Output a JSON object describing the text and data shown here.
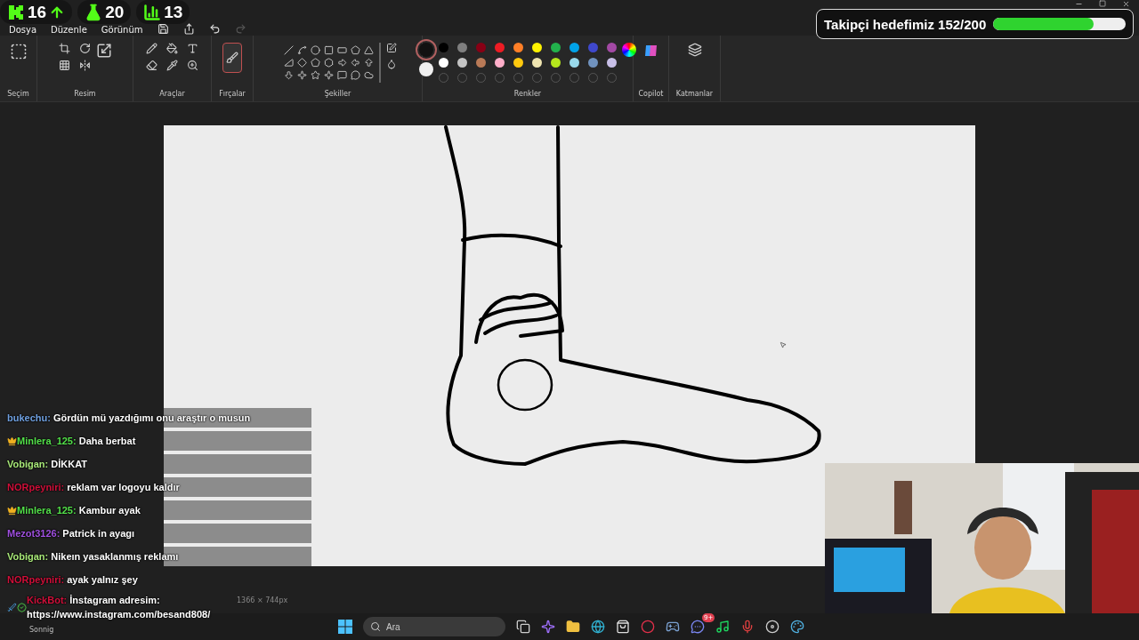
{
  "stream_stats": [
    {
      "kind": "kick",
      "value": "16"
    },
    {
      "kind": "followers",
      "value": "20"
    },
    {
      "kind": "viewers",
      "value": "13"
    }
  ],
  "menu": [
    "Dosya",
    "Düzenle",
    "Görünüm"
  ],
  "ribbon_groups": [
    "Seçim",
    "Resim",
    "Araçlar",
    "Fırçalar",
    "Şekiller",
    "Renkler",
    "Copilot",
    "Katmanlar"
  ],
  "colors": {
    "active": [
      {
        "color": "#111111",
        "selected": true
      },
      {
        "color": "#f0f0f0",
        "selected": false
      }
    ],
    "swatches": [
      {
        "color": "#000000"
      },
      {
        "color": "#7f7f7f"
      },
      {
        "color": "#880015"
      },
      {
        "color": "#ed1c24"
      },
      {
        "color": "#ff7f27"
      },
      {
        "color": "#fff200"
      },
      {
        "color": "#22b14c"
      },
      {
        "color": "#00a2e8"
      },
      {
        "color": "#3f48cc"
      },
      {
        "color": "#a349a4"
      },
      {
        "color": "#ffffff"
      },
      {
        "color": "#c3c3c3"
      },
      {
        "color": "#b97a57"
      },
      {
        "color": "#ffaec9"
      },
      {
        "color": "#ffc90e"
      },
      {
        "color": "#efe4b0"
      },
      {
        "color": "#b5e61d"
      },
      {
        "color": "#99d9ea"
      },
      {
        "color": "#7092be"
      },
      {
        "color": "#c8bfe7"
      }
    ]
  },
  "follower_goal": {
    "label": "Takipçi hedefimiz 152/200",
    "level": 0.76
  },
  "chat": [
    {
      "user": "bukechu:",
      "color": "#6fa0e0",
      "crown": false,
      "message": "Gördün mü yazdığımı onu araştır o musun"
    },
    {
      "user": "Minlera_125:",
      "color": "#53e04a",
      "crown": true,
      "message": "Daha berbat"
    },
    {
      "user": "Vobigan:",
      "color": "#a8e878",
      "crown": false,
      "message": "DİKKAT"
    },
    {
      "user": "NORpeyniri:",
      "color": "#d0103a",
      "crown": false,
      "message": "reklam var logoyu kaldır"
    },
    {
      "user": "Minlera_125:",
      "color": "#53e04a",
      "crown": true,
      "message": "Kambur ayak"
    },
    {
      "user": "Mezot3126:",
      "color": "#a050e0",
      "crown": false,
      "message": "Patrick in ayagı"
    },
    {
      "user": "Vobigan:",
      "color": "#a8e878",
      "crown": false,
      "message": "Nikeın yasaklanmış reklamı"
    },
    {
      "user": "NORpeyniri:",
      "color": "#d0103a",
      "crown": false,
      "message": "ayak yalnız şey"
    },
    {
      "user": "KickBot:",
      "color": "#d0103a",
      "crown": false,
      "bot": true,
      "message": "İnstagram adresim: https://www.instagram.com/besand808/"
    }
  ],
  "status_bar": {
    "canvas_size": "1366 × 744px"
  },
  "taskbar": {
    "search_placeholder": "Ara",
    "discord_badge": "9+",
    "weather": "Sonnig"
  }
}
